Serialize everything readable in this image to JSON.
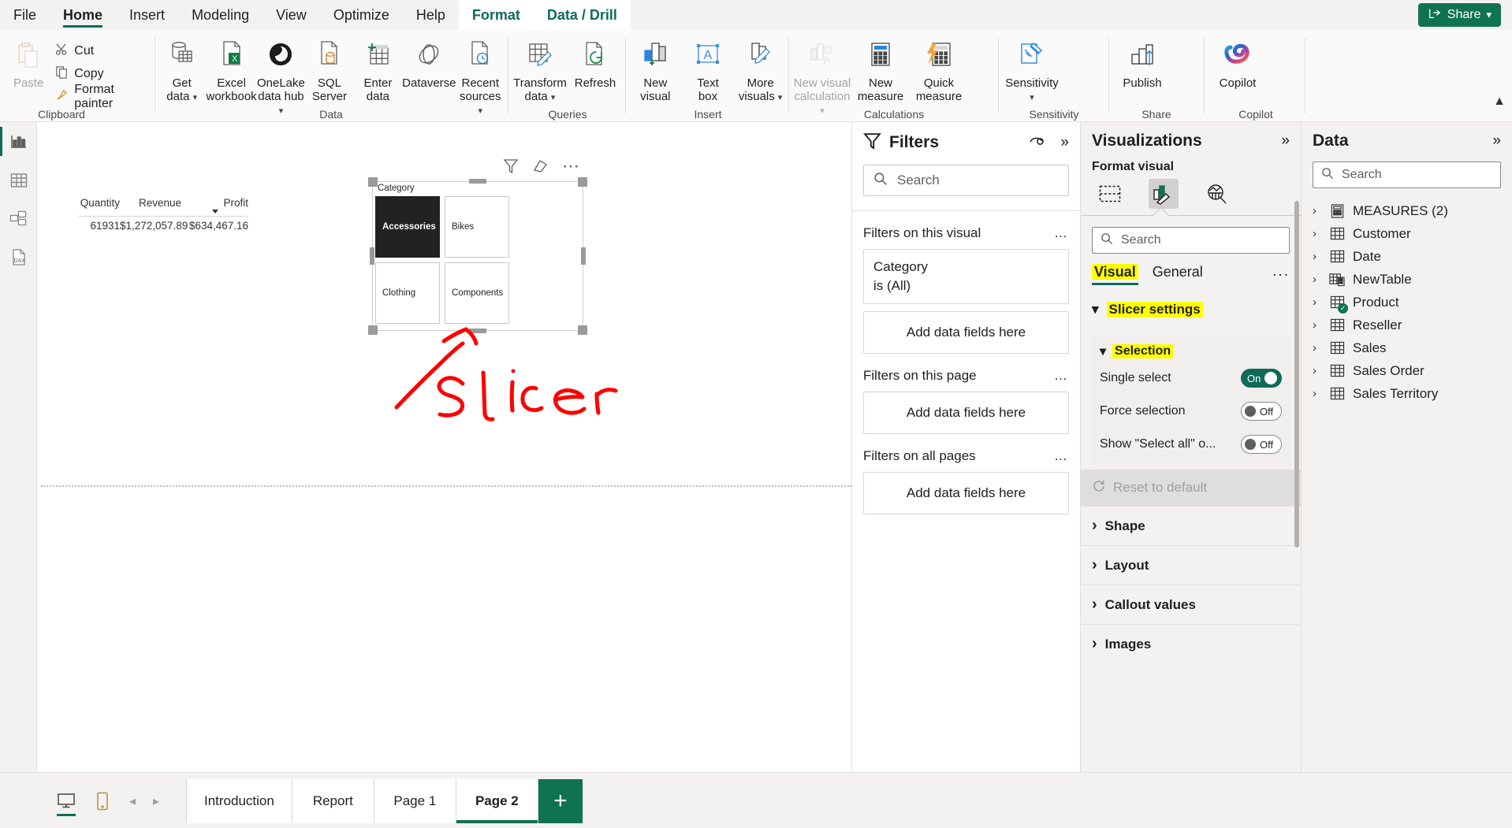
{
  "ribbon": {
    "tabs": [
      {
        "label": "File",
        "active": false,
        "contextual": false
      },
      {
        "label": "Home",
        "active": true,
        "contextual": false
      },
      {
        "label": "Insert",
        "active": false,
        "contextual": false
      },
      {
        "label": "Modeling",
        "active": false,
        "contextual": false
      },
      {
        "label": "View",
        "active": false,
        "contextual": false
      },
      {
        "label": "Optimize",
        "active": false,
        "contextual": false
      },
      {
        "label": "Help",
        "active": false,
        "contextual": false
      },
      {
        "label": "Format",
        "active": false,
        "contextual": true
      },
      {
        "label": "Data / Drill",
        "active": false,
        "contextual": true
      }
    ],
    "share_button": "Share",
    "groups": {
      "clipboard": {
        "label": "Clipboard",
        "paste": "Paste",
        "cut": "Cut",
        "copy": "Copy",
        "format_painter": "Format painter"
      },
      "data": {
        "label": "Data",
        "items": [
          {
            "l1": "Get",
            "l2": "data",
            "caret": true
          },
          {
            "l1": "Excel",
            "l2": "workbook",
            "caret": false
          },
          {
            "l1": "OneLake",
            "l2": "data hub",
            "caret": true
          },
          {
            "l1": "SQL",
            "l2": "Server",
            "caret": false
          },
          {
            "l1": "Enter",
            "l2": "data",
            "caret": false
          },
          {
            "l1": "Dataverse",
            "l2": "",
            "caret": false
          },
          {
            "l1": "Recent",
            "l2": "sources",
            "caret": true
          }
        ]
      },
      "queries": {
        "label": "Queries",
        "items": [
          {
            "l1": "Transform",
            "l2": "data",
            "caret": true
          },
          {
            "l1": "Refresh",
            "l2": "",
            "caret": false
          }
        ]
      },
      "insert": {
        "label": "Insert",
        "items": [
          {
            "l1": "New",
            "l2": "visual",
            "caret": false
          },
          {
            "l1": "Text",
            "l2": "box",
            "caret": false
          },
          {
            "l1": "More",
            "l2": "visuals",
            "caret": true
          }
        ]
      },
      "calculations": {
        "label": "Calculations",
        "items": [
          {
            "l1": "New visual",
            "l2": "calculation",
            "caret": true,
            "disabled": true
          },
          {
            "l1": "New",
            "l2": "measure",
            "caret": false,
            "disabled": false
          },
          {
            "l1": "Quick",
            "l2": "measure",
            "caret": false,
            "disabled": false
          }
        ]
      },
      "sensitivity": {
        "label": "Sensitivity",
        "items": [
          {
            "l1": "Sensitivity",
            "l2": "",
            "caret": true
          }
        ]
      },
      "share": {
        "label": "Share",
        "items": [
          {
            "l1": "Publish",
            "l2": "",
            "caret": false
          }
        ]
      },
      "copilot": {
        "label": "Copilot",
        "items": [
          {
            "l1": "Copilot",
            "l2": "",
            "caret": false
          }
        ]
      }
    }
  },
  "rail": {
    "items": [
      {
        "name": "report-view",
        "icon": "bar-chart-icon",
        "active": true
      },
      {
        "name": "table-view",
        "icon": "table-icon",
        "active": false
      },
      {
        "name": "model-view",
        "icon": "model-icon",
        "active": false
      },
      {
        "name": "dax-query-view",
        "icon": "dax-icon",
        "active": false
      }
    ]
  },
  "canvas": {
    "card_visual": {
      "columns": [
        "Quantity",
        "Revenue",
        "Profit"
      ],
      "values": [
        "61931",
        "$1,272,057.89",
        "$634,467.16"
      ],
      "sorted_column": "Profit"
    },
    "slicer": {
      "title": "Category",
      "items": [
        {
          "label": "Accessories",
          "selected": true
        },
        {
          "label": "Bikes",
          "selected": false
        },
        {
          "label": "Clothing",
          "selected": false
        },
        {
          "label": "Components",
          "selected": false
        }
      ],
      "hover_icons": [
        "filter-icon",
        "eraser-icon",
        "more-options-icon"
      ]
    },
    "annotation": "Slicer"
  },
  "filters_pane": {
    "title": "Filters",
    "search_placeholder": "Search",
    "sections": [
      {
        "heading": "Filters on this visual",
        "cards": [
          {
            "field": "Category",
            "condition": "is (All)"
          }
        ],
        "dropzone": "Add data fields here"
      },
      {
        "heading": "Filters on this page",
        "cards": [],
        "dropzone": "Add data fields here"
      },
      {
        "heading": "Filters on all pages",
        "cards": [],
        "dropzone": "Add data fields here"
      }
    ]
  },
  "visualizations_pane": {
    "title": "Visualizations",
    "subtitle": "Format visual",
    "icons": [
      {
        "name": "build-visual-icon",
        "active": false
      },
      {
        "name": "format-visual-icon",
        "active": true
      },
      {
        "name": "analytics-icon",
        "active": false
      }
    ],
    "search_placeholder": "Search",
    "tabs": [
      {
        "label": "Visual",
        "active": true,
        "highlighted": true
      },
      {
        "label": "General",
        "active": false,
        "highlighted": false
      }
    ],
    "more_label": "...",
    "slicer_settings": {
      "label": "Slicer settings",
      "highlighted": true,
      "selection": {
        "label": "Selection",
        "highlighted": true,
        "rows": [
          {
            "label": "Single select",
            "state": "On"
          },
          {
            "label": "Force selection",
            "state": "Off"
          },
          {
            "label": "Show \"Select all\" o...",
            "state": "Off"
          }
        ]
      },
      "reset": "Reset to default"
    },
    "collapsed_sections": [
      "Shape",
      "Layout",
      "Callout values",
      "Images"
    ]
  },
  "data_pane": {
    "title": "Data",
    "search_placeholder": "Search",
    "tables": [
      {
        "label": "MEASURES (2)",
        "icon": "measures-icon",
        "checked": false
      },
      {
        "label": "Customer",
        "icon": "table-icon",
        "checked": false
      },
      {
        "label": "Date",
        "icon": "table-icon",
        "checked": false
      },
      {
        "label": "NewTable",
        "icon": "calculated-table-icon",
        "checked": false
      },
      {
        "label": "Product",
        "icon": "table-icon",
        "checked": true
      },
      {
        "label": "Reseller",
        "icon": "table-icon",
        "checked": false
      },
      {
        "label": "Sales",
        "icon": "table-icon",
        "checked": false
      },
      {
        "label": "Sales Order",
        "icon": "table-icon",
        "checked": false
      },
      {
        "label": "Sales Territory",
        "icon": "table-icon",
        "checked": false
      }
    ]
  },
  "bottom_bar": {
    "view_buttons": [
      {
        "name": "desktop-layout-icon",
        "active": true
      },
      {
        "name": "mobile-layout-icon",
        "active": false
      }
    ],
    "nav_prev": "◂",
    "nav_next": "▸",
    "page_tabs": [
      {
        "label": "Introduction",
        "active": false
      },
      {
        "label": "Report",
        "active": false
      },
      {
        "label": "Page 1",
        "active": false
      },
      {
        "label": "Page 2",
        "active": true
      }
    ],
    "add_page": "+"
  },
  "colors": {
    "accent_green": "#0f7350",
    "tab_underline": "#0f6b57",
    "highlight_yellow": "#ffff00",
    "ink_red": "#ff0000",
    "selected_slicer_bg": "#222222"
  }
}
